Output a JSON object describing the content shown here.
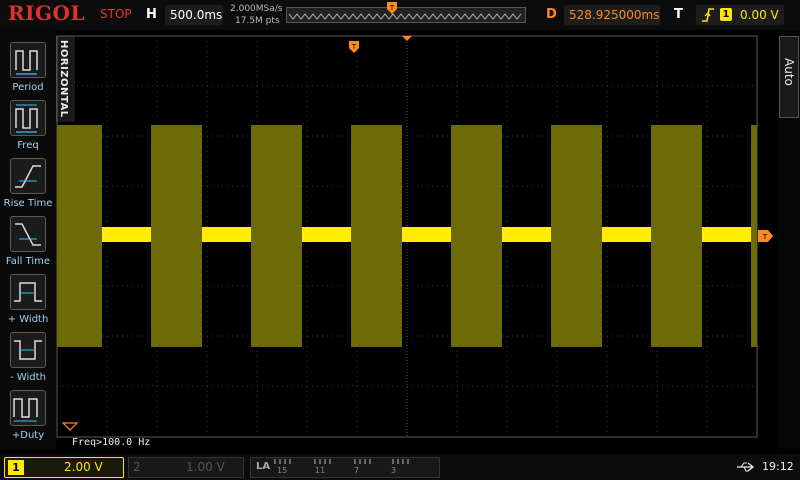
{
  "brand": "RIGOL",
  "top_bar": {
    "run_status": "STOP",
    "horizontal_letter": "H",
    "horizontal_scale": "500.0ms",
    "sample_rate": "2.000MSa/s",
    "memory_depth": "17.5M pts",
    "delay_letter": "D",
    "delay_value": "528.925000ms",
    "trigger_letter": "T",
    "trigger_source": "1",
    "trigger_level": "0.00 V"
  },
  "left_menu": {
    "title": "HORIZONTAL",
    "items": [
      {
        "label": "Period",
        "icon": "period-icon"
      },
      {
        "label": "Freq",
        "icon": "freq-icon"
      },
      {
        "label": "Rise Time",
        "icon": "rise-time-icon"
      },
      {
        "label": "Fall Time",
        "icon": "fall-time-icon"
      },
      {
        "label": "+ Width",
        "icon": "positive-width-icon"
      },
      {
        "label": "- Width",
        "icon": "negative-width-icon"
      },
      {
        "label": "+Duty",
        "icon": "positive-duty-icon"
      }
    ]
  },
  "right_panel": {
    "mode": "Auto"
  },
  "measurement": {
    "freq": "Freq>100.0 Hz"
  },
  "bottom_bar": {
    "ch1_number": "1",
    "ch1_scale": "2.00 V",
    "ch2_number": "2",
    "ch2_scale": "1.00 V",
    "la_label": "LA",
    "la_channels": [
      "15",
      "11",
      "7",
      "3"
    ],
    "time": "19:12"
  },
  "colors": {
    "ch1": "#ffe800",
    "trigger": "#ff8a1c",
    "status_stop": "#e03a2a",
    "grid": "#555555"
  }
}
